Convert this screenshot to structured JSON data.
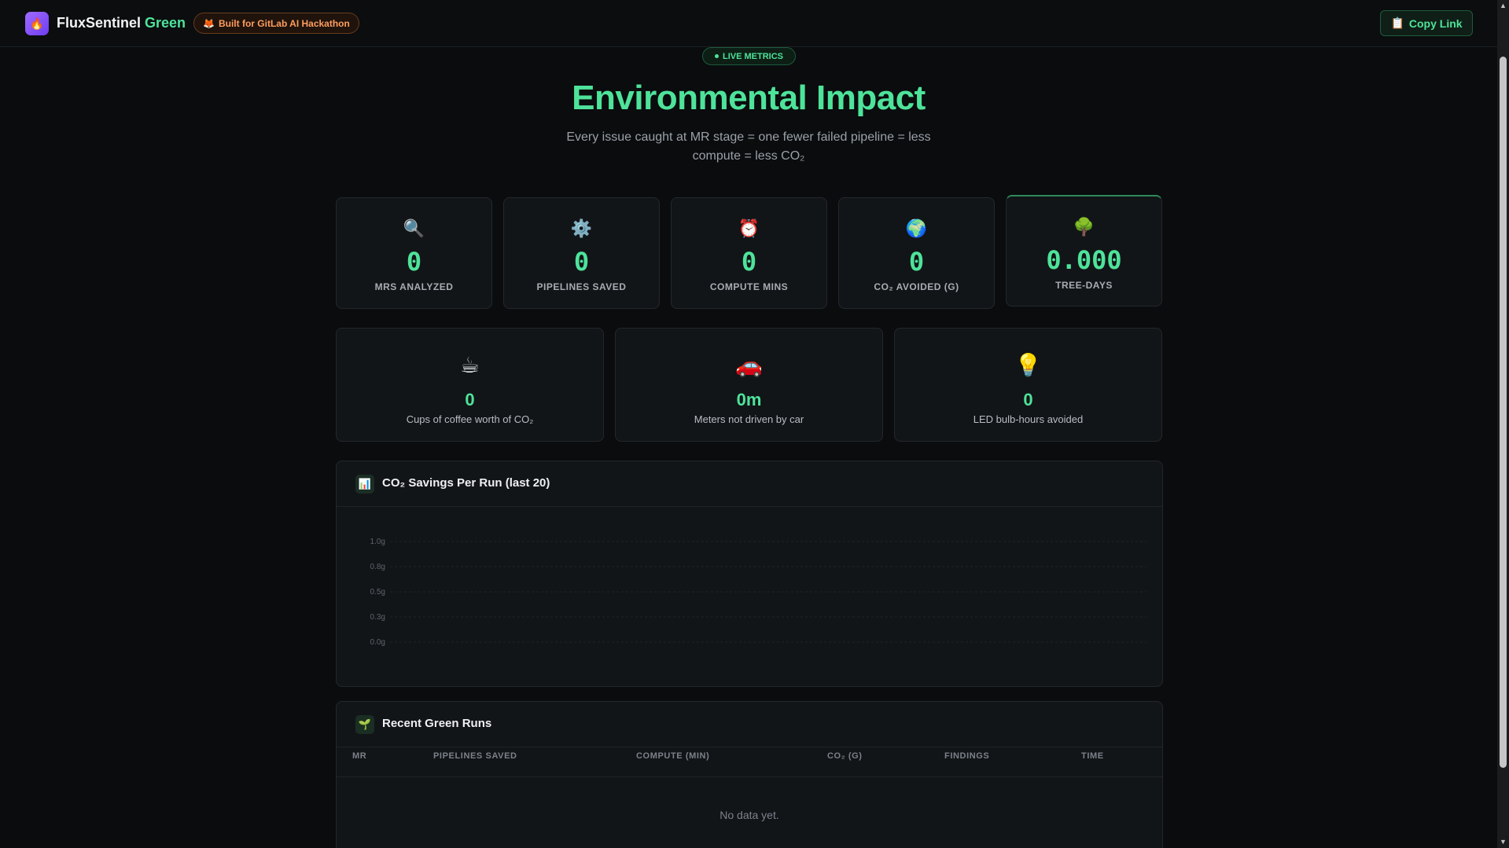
{
  "header": {
    "brand_main": "FluxSentinel",
    "brand_accent": "Green",
    "badge_icon": "🦊",
    "badge_label": "Built for GitLab AI Hackathon",
    "copy_icon": "📋",
    "copy_label": "Copy Link"
  },
  "hero": {
    "live_label": "LIVE METRICS",
    "title": "Environmental Impact",
    "subtitle": "Every issue caught at MR stage = one fewer failed pipeline = less compute = less CO₂"
  },
  "stats": [
    {
      "icon": "🔍",
      "icon_name": "magnifier-icon",
      "value": "0",
      "label": "MRS ANALYZED"
    },
    {
      "icon": "⚙️",
      "icon_name": "gear-icon",
      "value": "0",
      "label": "PIPELINES SAVED"
    },
    {
      "icon": "⏰",
      "icon_name": "alarm-clock-icon",
      "value": "0",
      "label": "COMPUTE MINS"
    },
    {
      "icon": "🌍",
      "icon_name": "globe-icon",
      "value": "0",
      "label": "CO₂ AVOIDED (G)"
    },
    {
      "icon": "🌳",
      "icon_name": "tree-icon",
      "value": "0.000",
      "label": "TREE-DAYS"
    }
  ],
  "equivalents": [
    {
      "icon": "☕",
      "icon_name": "coffee-icon",
      "value": "0",
      "label": "Cups of coffee worth of CO₂"
    },
    {
      "icon": "🚗",
      "icon_name": "car-icon",
      "value": "0m",
      "label": "Meters not driven by car"
    },
    {
      "icon": "💡",
      "icon_name": "lightbulb-icon",
      "value": "0",
      "label": "LED bulb-hours avoided"
    }
  ],
  "chart_panel": {
    "icon": "📊",
    "title": "CO₂ Savings Per Run (last 20)"
  },
  "chart_data": {
    "type": "bar",
    "title": "CO₂ Savings Per Run (last 20)",
    "categories": [],
    "values": [],
    "yticks": [
      "0.0g",
      "0.3g",
      "0.5g",
      "0.8g",
      "1.0g"
    ],
    "ylim": [
      0,
      1.0
    ],
    "grid": true
  },
  "runs_panel": {
    "icon": "🌱",
    "title": "Recent Green Runs",
    "columns": [
      "MR",
      "PIPELINES SAVED",
      "COMPUTE (MIN)",
      "CO₂ (G)",
      "FINDINGS",
      "TIME"
    ],
    "rows": [],
    "empty_message": "No data yet."
  },
  "colors": {
    "accent": "#4ee39a",
    "background": "#0a0c0e",
    "card": "#121518",
    "badge_orange": "#ff9d5c"
  }
}
